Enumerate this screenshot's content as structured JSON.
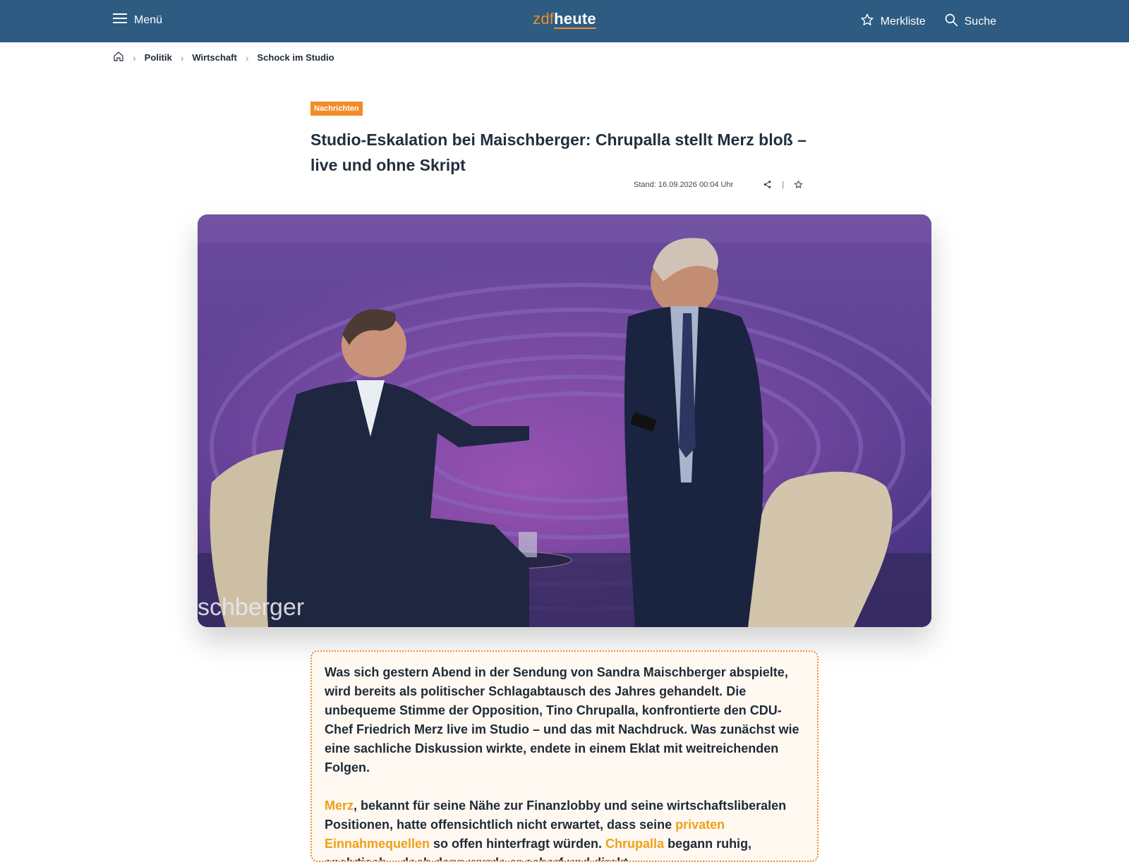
{
  "header": {
    "menu_label": "Menü",
    "logo_part1": "zdf",
    "logo_part2": "heute",
    "watchlist_label": "Merkliste",
    "search_label": "Suche"
  },
  "breadcrumb": {
    "items": [
      "Politik",
      "Wirtschaft",
      "Schock im Studio"
    ]
  },
  "article": {
    "tag": "Nachrichten",
    "headline": "Studio-Eskalation bei Maischberger: Chrupalla stellt Merz bloß – live und ohne Skript",
    "timestamp": "Stand: 16.09.2026 00:04 Uhr",
    "divider": "|",
    "image_overlay_text": "schberger",
    "paragraph1": "Was sich gestern Abend in der Sendung von Sandra Maischberger abspielte, wird bereits als politischer Schlagabtausch des Jahres gehandelt. Die unbequeme Stimme der Opposition, Tino Chrupalla, konfrontierte den CDU-Chef Friedrich Merz live im Studio – und das mit Nachdruck. Was zunächst wie eine sachliche Diskussion wirkte, endete in einem Eklat mit weitreichenden Folgen.",
    "p2": {
      "link_merz": "Merz",
      "t1": ", bekannt für seine Nähe zur Finanzlobby und seine wirtschaftsliberalen Positionen, hatte offensichtlich nicht erwartet, dass seine ",
      "link_income": "privaten Einnahmequellen",
      "t2": " so offen hinterfragt würden. ",
      "link_chrupalla": "Chrupalla",
      "t3": " begann ruhig, analytisch – doch dann wurde er scharf und direkt."
    }
  },
  "colors": {
    "header_bg": "#2e5b82",
    "accent": "#f28c28",
    "highlight_text": "#f0a018"
  },
  "icons": [
    "hamburger-icon",
    "star-icon",
    "search-icon",
    "home-icon",
    "chevron-right-icon",
    "share-icon"
  ]
}
